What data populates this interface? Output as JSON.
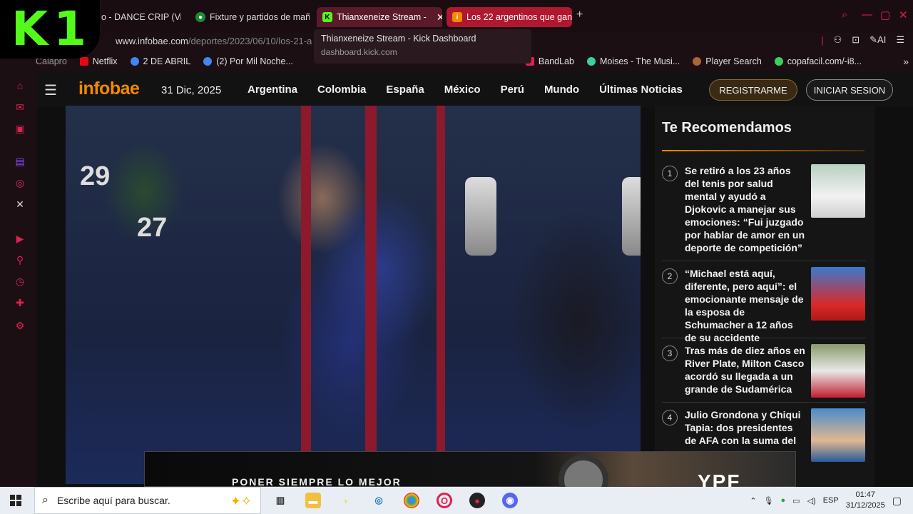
{
  "logo": {
    "text": "K1"
  },
  "tabs": [
    {
      "label": "o - DANCE CRIP (Vid",
      "icon": "tab-icon"
    },
    {
      "label": "Fixture y partidos de mañ",
      "icon": "chrome-icon"
    },
    {
      "label": "Thianxeneize Stream -",
      "icon": "kick-icon",
      "active": true
    },
    {
      "label": "Los 22 argentinos que gan",
      "icon": "infobae-icon"
    }
  ],
  "new_tab_label": "+",
  "tooltip": {
    "title": "Thianxeneize Stream - Kick Dashboard",
    "url": "dashboard.kick.com"
  },
  "address": {
    "domain": "www.infobae.com",
    "path": "/deportes/2023/06/10/los-21-a"
  },
  "address_right": {
    "ai_label": "AI"
  },
  "bookmarks": [
    {
      "label": "Netflix",
      "color": "#e50914"
    },
    {
      "label": "2 DE ABRIL",
      "color": "#4285f4"
    },
    {
      "label": "(2) Por Mil Noche...",
      "color": "#4285f4"
    },
    {
      "label": "BandLab",
      "color": "#e02050"
    },
    {
      "label": "Moises - The Musi...",
      "color": "#3ad1a0"
    },
    {
      "label": "Player Search",
      "color": "#aa6633"
    },
    {
      "label": "copafacil.com/-i8...",
      "color": "#3ad15a"
    }
  ],
  "bookmark_partial": "Calapro",
  "site": {
    "brand": "infobae",
    "date": "31 Dic, 2025",
    "nav": [
      "Argentina",
      "Colombia",
      "España",
      "México",
      "Perú",
      "Mundo",
      "Últimas Noticias"
    ],
    "register": "REGISTRARME",
    "login": "INICIAR SESION"
  },
  "recommendations": {
    "title": "Te Recomendamos",
    "items": [
      {
        "num": "1",
        "text": "Se retiró a los 23 años del tenis por salud mental y ayudó a Djokovic a manejar sus emociones: “Fui juzgado por hablar de amor en un deporte de competición”"
      },
      {
        "num": "2",
        "text": "“Michael está aquí, diferente, pero aquí”: el emocionante mensaje de la esposa de Schumacher a 12 años de su accidente"
      },
      {
        "num": "3",
        "text": "Tras más de diez años en River Plate, Milton Casco acordó su llegada a un grande de Sudamérica"
      },
      {
        "num": "4",
        "text": "Julio Grondona y Chiqui Tapia: dos presidentes de AFA con la suma del"
      }
    ]
  },
  "ad": {
    "text": "PONER SIEMPRE LO MEJOR",
    "brand": "YPF"
  },
  "jersey_numbers": [
    "29",
    "27"
  ],
  "taskbar": {
    "search_placeholder": "Escribe aquí para buscar.",
    "lang": "ESP",
    "time": "01:47",
    "date": "31/12/2025"
  }
}
